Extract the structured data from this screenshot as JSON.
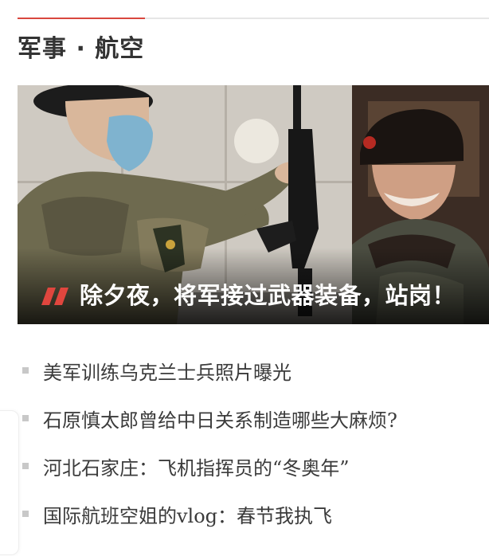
{
  "section": {
    "title": "军事 · 航空"
  },
  "featured": {
    "title": "除夕夜，将军接过武器装备，站岗！",
    "image_icon": "military-photo-icon",
    "accent_color": "#e0463e"
  },
  "news": [
    {
      "title": "美军训练乌克兰士兵照片曝光"
    },
    {
      "title": "石原慎太郎曾给中日关系制造哪些大麻烦?"
    },
    {
      "title": "河北石家庄：飞机指挥员的“冬奥年”"
    },
    {
      "title": "国际航班空姐的vlog：春节我执飞"
    }
  ],
  "colors": {
    "accent": "#d9473f",
    "bullet": "#c8c8c8",
    "text": "#333333"
  }
}
